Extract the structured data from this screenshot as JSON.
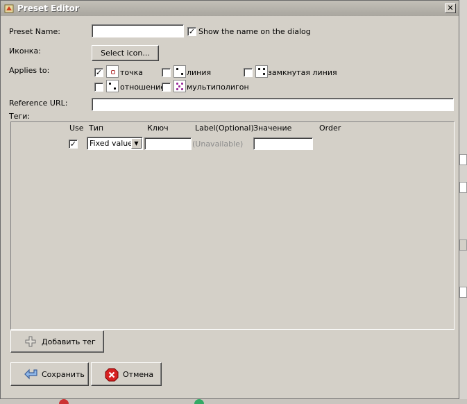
{
  "window": {
    "title": "Preset Editor",
    "close_glyph": "✕"
  },
  "form": {
    "preset_name_label": "Preset Name:",
    "preset_name_value": "",
    "show_name_checked": true,
    "show_name_label": "Show the name on the dialog",
    "icon_label": "Иконка:",
    "select_icon_button": "Select icon...",
    "applies_to_label": "Applies to:",
    "applies_to": [
      {
        "label": "точка",
        "checked": true,
        "icon": "node-icon"
      },
      {
        "label": "линия",
        "checked": false,
        "icon": "way-icon"
      },
      {
        "label": "замкнутая линия",
        "checked": false,
        "icon": "closed-way-icon"
      },
      {
        "label": "отношение",
        "checked": false,
        "icon": "relation-icon"
      },
      {
        "label": "мультиполигон",
        "checked": false,
        "icon": "multipolygon-icon"
      }
    ],
    "reference_url_label": "Reference URL:",
    "reference_url_value": "",
    "tags_label": "Теги:"
  },
  "tags_table": {
    "headers": [
      "Use",
      "Тип",
      "Ключ",
      "Label(Optional)",
      "Значение",
      "Order"
    ],
    "rows": [
      {
        "use": true,
        "type": "Fixed value",
        "key": "",
        "label": "(Unavailable)",
        "value": ""
      }
    ]
  },
  "buttons": {
    "add_tag": "Добавить тег",
    "save": "Сохранить",
    "cancel": "Отмена"
  },
  "check_glyph": "✓",
  "dropdown_glyph": "▼"
}
